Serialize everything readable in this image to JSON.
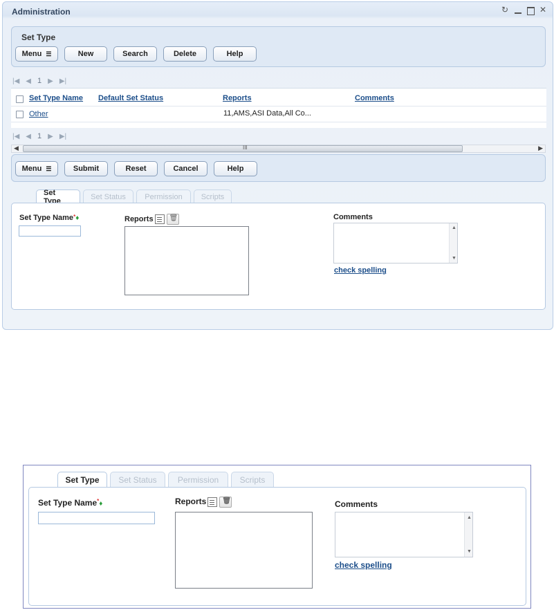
{
  "window": {
    "title": "Administration",
    "controls": [
      "refresh-icon",
      "minimize-icon",
      "maximize-icon",
      "close-icon"
    ]
  },
  "top_panel": {
    "title": "Set Type",
    "buttons": {
      "menu": "Menu",
      "new": "New",
      "search": "Search",
      "delete": "Delete",
      "help": "Help"
    }
  },
  "pager": {
    "page": "1"
  },
  "grid": {
    "headers": {
      "name": "Set Type Name",
      "status": "Default Set Status",
      "reports": "Reports",
      "comments": "Comments"
    },
    "rows": [
      {
        "name": "Other",
        "status": "",
        "reports": "11,AMS,ASI Data,All Co...",
        "comments": ""
      }
    ]
  },
  "bottom_panel": {
    "buttons": {
      "menu": "Menu",
      "submit": "Submit",
      "reset": "Reset",
      "cancel": "Cancel",
      "help": "Help"
    }
  },
  "tabs": {
    "set_type": "Set Type",
    "set_status": "Set Status",
    "permission": "Permission",
    "scripts": "Scripts"
  },
  "form": {
    "name_label": "Set Type Name",
    "required_mark": "*",
    "diamond": "♦",
    "reports_label": "Reports",
    "comments_label": "Comments",
    "spell_link": "check spelling"
  },
  "colors": {
    "panel_bg": "#dfe9f5",
    "link": "#1c4e8a",
    "required_diamond": "#2a9d3a"
  }
}
